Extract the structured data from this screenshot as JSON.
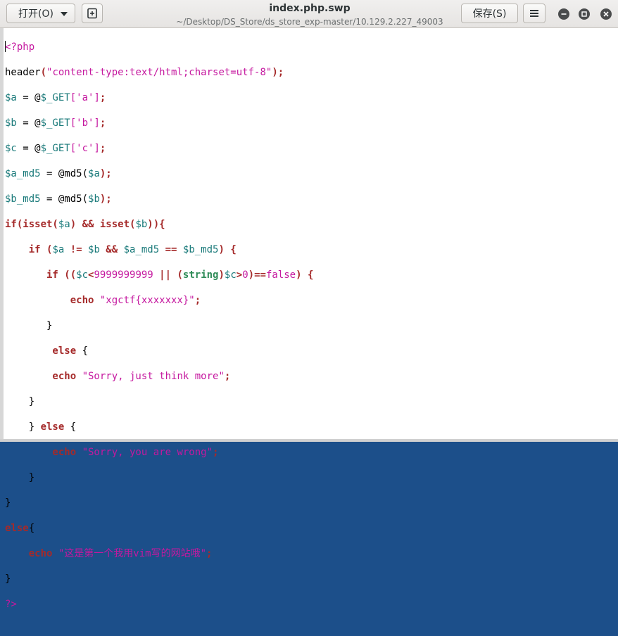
{
  "window": {
    "title": "index.php.swp",
    "subtitle": "~/Desktop/DS_Store/ds_store_exp-master/10.129.2.227_49003"
  },
  "toolbar": {
    "open_label": "打开(O)",
    "save_label": "保存(S)"
  },
  "icons": {
    "open_dropdown": "chevron-down-icon",
    "new_document": "new-document-icon",
    "menu": "hamburger-menu-icon",
    "minimize": "minimize-icon",
    "maximize": "maximize-icon",
    "close": "close-icon"
  },
  "code": {
    "l1_open": "<?php",
    "l2_fn": "header",
    "l2_str": "\"content-type:text/html;charset=utf-8\"",
    "l3_var": "$a",
    "l3_rest": " = @",
    "l3_get": "$_GET",
    "l3_idx": "['a']",
    "l4_var": "$b",
    "l4_rest": " = @",
    "l4_get": "$_GET",
    "l4_idx": "['b']",
    "l5_var": "$c",
    "l5_rest": " = @",
    "l5_get": "$_GET",
    "l5_idx": "['c']",
    "l6_var": "$a_md5",
    "l6_rest": " = @md5(",
    "l6_arg": "$a",
    "l7_var": "$b_md5",
    "l7_rest": " = @md5(",
    "l7_arg": "$b",
    "l8_if": "if(isset(",
    "l8_a": "$a",
    "l8_mid": ") && isset(",
    "l8_b": "$b",
    "l8_end": ")){",
    "l9_if": "    if (",
    "l9_a": "$a",
    "l9_op1": " != ",
    "l9_b": "$b",
    "l9_op2": " && ",
    "l9_amd5": "$a_md5",
    "l9_op3": " == ",
    "l9_bmd5": "$b_md5",
    "l9_end": ") {",
    "l10_if": "       if ((",
    "l10_c": "$c",
    "l10_lt": "<",
    "l10_num": "9999999999",
    "l10_or": " || (",
    "l10_type": "string",
    "l10_close": ")",
    "l10_c2": "$c",
    "l10_gt": ">",
    "l10_zero": "0",
    "l10_eq": ")==",
    "l10_false": "false",
    "l10_end": ") {",
    "l11_echo": "           echo ",
    "l11_str": "\"xgctf{xxxxxxx}\"",
    "l12": "       }",
    "l13_else": "        else",
    "l13_brace": " {",
    "l14_echo": "        echo ",
    "l14_str": "\"Sorry, just think more\"",
    "l15": "    }",
    "l16_close": "    } ",
    "l16_else": "else",
    "l16_brace": " {",
    "l17_echo": "        echo ",
    "l17_str": "\"Sorry, you are wrong\"",
    "l18": "    }",
    "l19": "}",
    "l20_else": "else",
    "l20_brace": "{",
    "l21_echo": "    echo ",
    "l21_str": "\"这是第一个我用vim写的网站哦\"",
    "l22": "}",
    "l23": "?>"
  },
  "colors": {
    "string": "#c5189f",
    "variable": "#1a7a7a",
    "keyword": "#a52a2a"
  }
}
